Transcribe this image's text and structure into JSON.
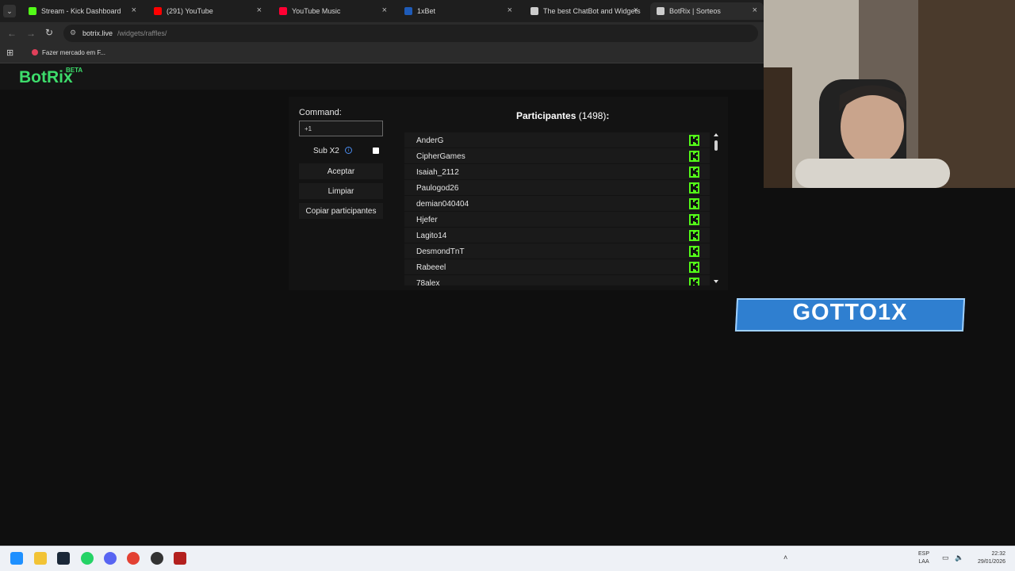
{
  "browser": {
    "tabs": [
      {
        "title": "Stream - Kick Dashboard",
        "color": "#53fc18"
      },
      {
        "title": "(291) YouTube",
        "color": "#ff0000"
      },
      {
        "title": "YouTube Music",
        "color": "#ff0033"
      },
      {
        "title": "1xBet",
        "color": "#1e5bb8"
      },
      {
        "title": "The best ChatBot and Widgets",
        "color": "#cccccc"
      },
      {
        "title": "BotRix | Sorteos",
        "color": "#cccccc"
      }
    ],
    "url_host": "botrix.live",
    "url_path": "/widgets/raffles/",
    "bookmark": "Fazer mercado em F..."
  },
  "page": {
    "logo": "BotRix",
    "logo_badge": "BETA",
    "command_label": "Command:",
    "command_value": "+1",
    "sub_label": "Sub X2",
    "sub_checked": false,
    "buttons": {
      "accept": "Aceptar",
      "clear": "Limpiar",
      "copy": "Copiar participantes"
    },
    "participants_title": "Participantes",
    "participants_count": "(1498)",
    "participants_colon": ":",
    "participants": [
      "AnderG",
      "CipherGames",
      "Isaiah_2112",
      "Paulogod26",
      "demian040404",
      "Hjefer",
      "Lagito14",
      "DesmondTnT",
      "Rabeeel",
      "78alex"
    ],
    "platform_color": "#53fc18"
  },
  "overlay": {
    "banner_text": "GOTTO1X"
  },
  "taskbar": {
    "lang_line1": "ESP",
    "lang_line2": "LAA",
    "time": "22:32",
    "date": "29/01/2026"
  }
}
